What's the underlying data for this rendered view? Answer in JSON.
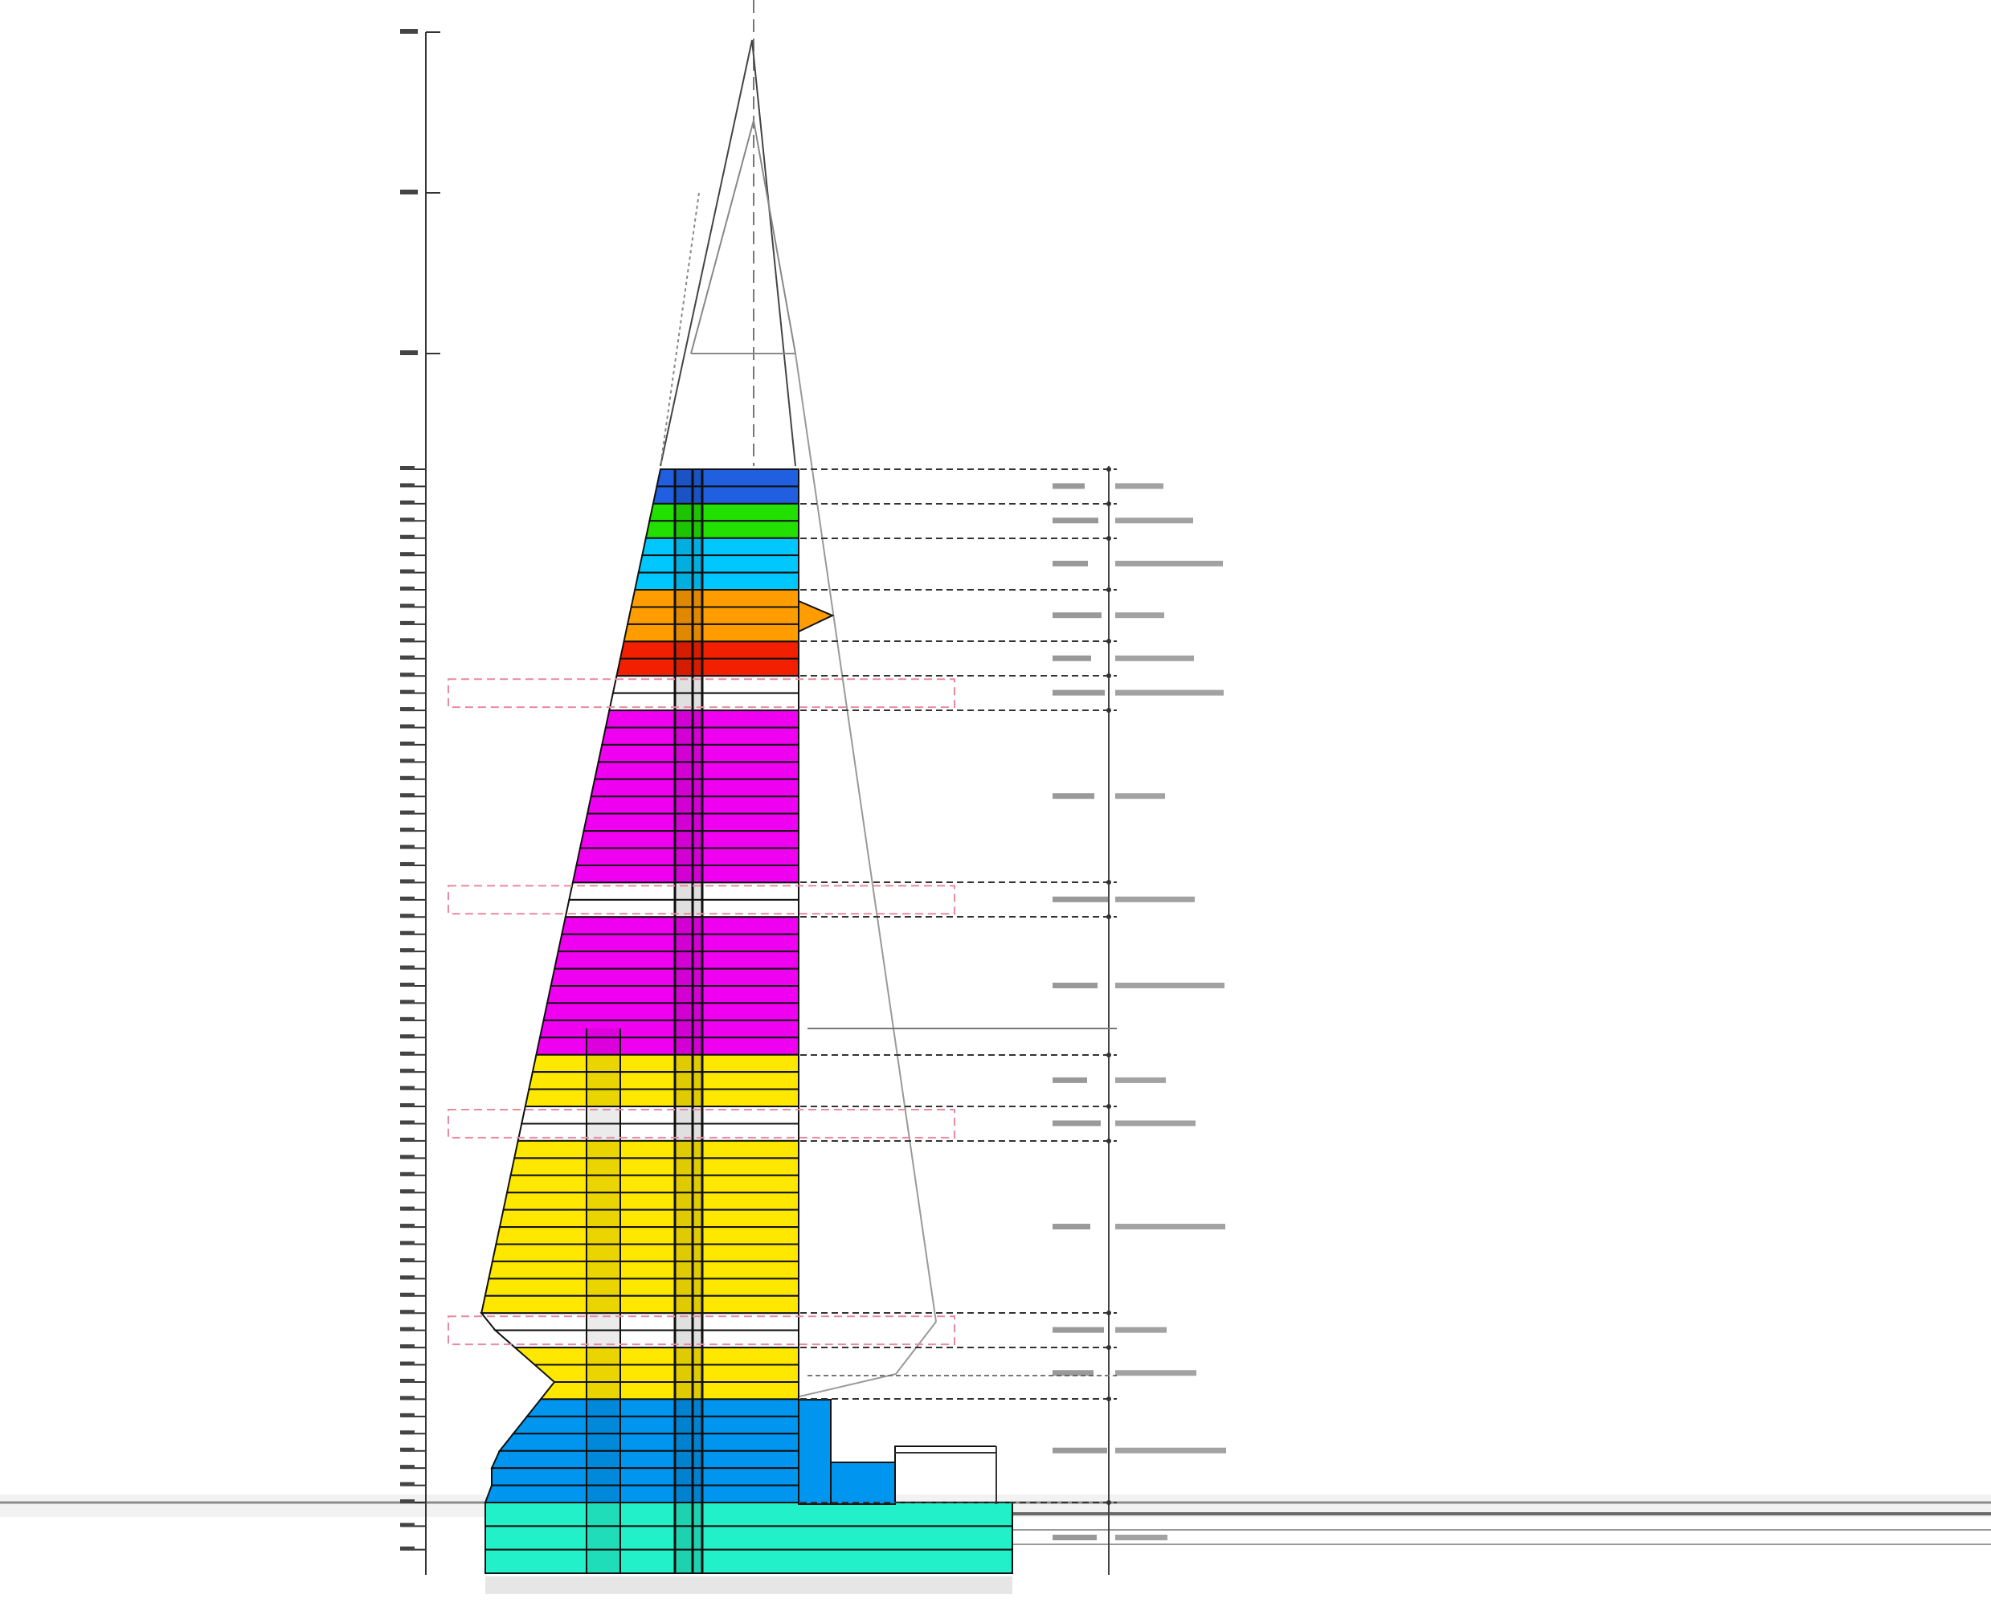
{
  "diagram": {
    "kind": "building-section",
    "zone_colors": {
      "crown": "#1f5fe0",
      "observation": "#22e000",
      "sky_lobby_upper": "#00c8ff",
      "club": "#ff9d00",
      "restaurant": "#f22000",
      "hotel": "#f000f0",
      "office": "#ffe800",
      "podium": "#0095ee",
      "basement": "#22f0c8",
      "refuge": "#ffffff",
      "outline": "#111111",
      "refuge_marker": "#e88aa0",
      "leader": "#333333",
      "ground": "#9a9a9a"
    },
    "floor_plan": [
      {
        "zone": "crown",
        "floors": 2
      },
      {
        "zone": "observation",
        "floors": 2
      },
      {
        "zone": "sky_lobby_upper",
        "floors": 3
      },
      {
        "zone": "club",
        "floors": 3
      },
      {
        "zone": "restaurant",
        "floors": 2
      },
      {
        "zone": "refuge",
        "floors": 2
      },
      {
        "zone": "hotel",
        "floors": 10
      },
      {
        "zone": "refuge",
        "floors": 2
      },
      {
        "zone": "hotel",
        "floors": 8
      },
      {
        "zone": "office",
        "floors": 3
      },
      {
        "zone": "refuge",
        "floors": 2
      },
      {
        "zone": "office",
        "floors": 10
      },
      {
        "zone": "refuge",
        "floors": 2
      },
      {
        "zone": "office",
        "floors": 3
      },
      {
        "zone": "podium",
        "floors": 6
      },
      {
        "zone": "basement",
        "floors": 3
      }
    ]
  }
}
